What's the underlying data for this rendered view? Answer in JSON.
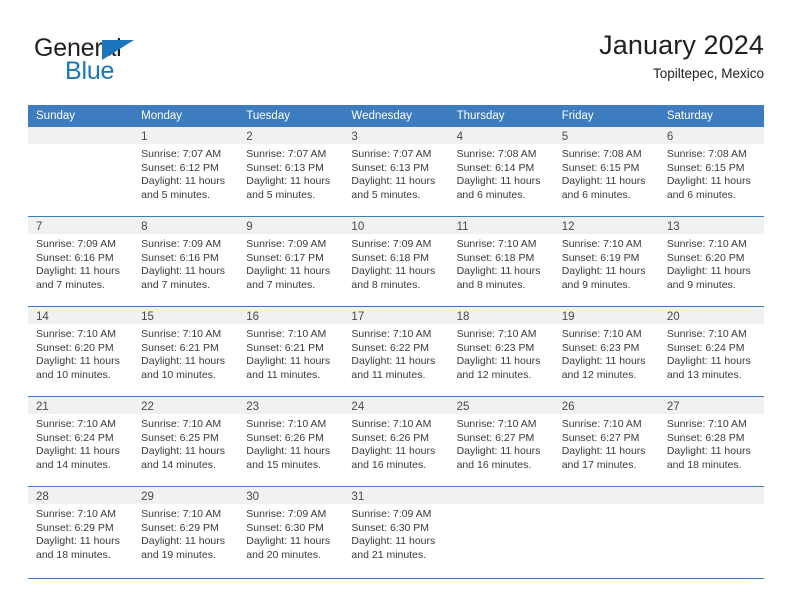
{
  "brand": {
    "name_part1": "General",
    "name_part2": "Blue",
    "triangle_icon": "triangle-icon",
    "colors": {
      "dark": "#231f20",
      "blue": "#1b75bc"
    }
  },
  "header": {
    "title": "January 2024",
    "subtitle": "Topiltepec, Mexico"
  },
  "theme": {
    "header_blue": "#3d7cbf",
    "daynum_band": "#f1f1f1",
    "text": "#3a3a3a"
  },
  "calendar": {
    "weekday_headers": [
      "Sunday",
      "Monday",
      "Tuesday",
      "Wednesday",
      "Thursday",
      "Friday",
      "Saturday"
    ],
    "weeks": [
      [
        {
          "day": "",
          "empty": true,
          "sunrise": "",
          "sunset": "",
          "daylight_line1": "",
          "daylight_line2": ""
        },
        {
          "day": "1",
          "sunrise": "Sunrise: 7:07 AM",
          "sunset": "Sunset: 6:12 PM",
          "daylight_line1": "Daylight: 11 hours",
          "daylight_line2": "and 5 minutes."
        },
        {
          "day": "2",
          "sunrise": "Sunrise: 7:07 AM",
          "sunset": "Sunset: 6:13 PM",
          "daylight_line1": "Daylight: 11 hours",
          "daylight_line2": "and 5 minutes."
        },
        {
          "day": "3",
          "sunrise": "Sunrise: 7:07 AM",
          "sunset": "Sunset: 6:13 PM",
          "daylight_line1": "Daylight: 11 hours",
          "daylight_line2": "and 5 minutes."
        },
        {
          "day": "4",
          "sunrise": "Sunrise: 7:08 AM",
          "sunset": "Sunset: 6:14 PM",
          "daylight_line1": "Daylight: 11 hours",
          "daylight_line2": "and 6 minutes."
        },
        {
          "day": "5",
          "sunrise": "Sunrise: 7:08 AM",
          "sunset": "Sunset: 6:15 PM",
          "daylight_line1": "Daylight: 11 hours",
          "daylight_line2": "and 6 minutes."
        },
        {
          "day": "6",
          "sunrise": "Sunrise: 7:08 AM",
          "sunset": "Sunset: 6:15 PM",
          "daylight_line1": "Daylight: 11 hours",
          "daylight_line2": "and 6 minutes."
        }
      ],
      [
        {
          "day": "7",
          "sunrise": "Sunrise: 7:09 AM",
          "sunset": "Sunset: 6:16 PM",
          "daylight_line1": "Daylight: 11 hours",
          "daylight_line2": "and 7 minutes."
        },
        {
          "day": "8",
          "sunrise": "Sunrise: 7:09 AM",
          "sunset": "Sunset: 6:16 PM",
          "daylight_line1": "Daylight: 11 hours",
          "daylight_line2": "and 7 minutes."
        },
        {
          "day": "9",
          "sunrise": "Sunrise: 7:09 AM",
          "sunset": "Sunset: 6:17 PM",
          "daylight_line1": "Daylight: 11 hours",
          "daylight_line2": "and 7 minutes."
        },
        {
          "day": "10",
          "sunrise": "Sunrise: 7:09 AM",
          "sunset": "Sunset: 6:18 PM",
          "daylight_line1": "Daylight: 11 hours",
          "daylight_line2": "and 8 minutes."
        },
        {
          "day": "11",
          "sunrise": "Sunrise: 7:10 AM",
          "sunset": "Sunset: 6:18 PM",
          "daylight_line1": "Daylight: 11 hours",
          "daylight_line2": "and 8 minutes."
        },
        {
          "day": "12",
          "sunrise": "Sunrise: 7:10 AM",
          "sunset": "Sunset: 6:19 PM",
          "daylight_line1": "Daylight: 11 hours",
          "daylight_line2": "and 9 minutes."
        },
        {
          "day": "13",
          "sunrise": "Sunrise: 7:10 AM",
          "sunset": "Sunset: 6:20 PM",
          "daylight_line1": "Daylight: 11 hours",
          "daylight_line2": "and 9 minutes."
        }
      ],
      [
        {
          "day": "14",
          "sunrise": "Sunrise: 7:10 AM",
          "sunset": "Sunset: 6:20 PM",
          "daylight_line1": "Daylight: 11 hours",
          "daylight_line2": "and 10 minutes."
        },
        {
          "day": "15",
          "sunrise": "Sunrise: 7:10 AM",
          "sunset": "Sunset: 6:21 PM",
          "daylight_line1": "Daylight: 11 hours",
          "daylight_line2": "and 10 minutes."
        },
        {
          "day": "16",
          "sunrise": "Sunrise: 7:10 AM",
          "sunset": "Sunset: 6:21 PM",
          "daylight_line1": "Daylight: 11 hours",
          "daylight_line2": "and 11 minutes."
        },
        {
          "day": "17",
          "sunrise": "Sunrise: 7:10 AM",
          "sunset": "Sunset: 6:22 PM",
          "daylight_line1": "Daylight: 11 hours",
          "daylight_line2": "and 11 minutes."
        },
        {
          "day": "18",
          "sunrise": "Sunrise: 7:10 AM",
          "sunset": "Sunset: 6:23 PM",
          "daylight_line1": "Daylight: 11 hours",
          "daylight_line2": "and 12 minutes."
        },
        {
          "day": "19",
          "sunrise": "Sunrise: 7:10 AM",
          "sunset": "Sunset: 6:23 PM",
          "daylight_line1": "Daylight: 11 hours",
          "daylight_line2": "and 12 minutes."
        },
        {
          "day": "20",
          "sunrise": "Sunrise: 7:10 AM",
          "sunset": "Sunset: 6:24 PM",
          "daylight_line1": "Daylight: 11 hours",
          "daylight_line2": "and 13 minutes."
        }
      ],
      [
        {
          "day": "21",
          "sunrise": "Sunrise: 7:10 AM",
          "sunset": "Sunset: 6:24 PM",
          "daylight_line1": "Daylight: 11 hours",
          "daylight_line2": "and 14 minutes."
        },
        {
          "day": "22",
          "sunrise": "Sunrise: 7:10 AM",
          "sunset": "Sunset: 6:25 PM",
          "daylight_line1": "Daylight: 11 hours",
          "daylight_line2": "and 14 minutes."
        },
        {
          "day": "23",
          "sunrise": "Sunrise: 7:10 AM",
          "sunset": "Sunset: 6:26 PM",
          "daylight_line1": "Daylight: 11 hours",
          "daylight_line2": "and 15 minutes."
        },
        {
          "day": "24",
          "sunrise": "Sunrise: 7:10 AM",
          "sunset": "Sunset: 6:26 PM",
          "daylight_line1": "Daylight: 11 hours",
          "daylight_line2": "and 16 minutes."
        },
        {
          "day": "25",
          "sunrise": "Sunrise: 7:10 AM",
          "sunset": "Sunset: 6:27 PM",
          "daylight_line1": "Daylight: 11 hours",
          "daylight_line2": "and 16 minutes."
        },
        {
          "day": "26",
          "sunrise": "Sunrise: 7:10 AM",
          "sunset": "Sunset: 6:27 PM",
          "daylight_line1": "Daylight: 11 hours",
          "daylight_line2": "and 17 minutes."
        },
        {
          "day": "27",
          "sunrise": "Sunrise: 7:10 AM",
          "sunset": "Sunset: 6:28 PM",
          "daylight_line1": "Daylight: 11 hours",
          "daylight_line2": "and 18 minutes."
        }
      ],
      [
        {
          "day": "28",
          "sunrise": "Sunrise: 7:10 AM",
          "sunset": "Sunset: 6:29 PM",
          "daylight_line1": "Daylight: 11 hours",
          "daylight_line2": "and 18 minutes."
        },
        {
          "day": "29",
          "sunrise": "Sunrise: 7:10 AM",
          "sunset": "Sunset: 6:29 PM",
          "daylight_line1": "Daylight: 11 hours",
          "daylight_line2": "and 19 minutes."
        },
        {
          "day": "30",
          "sunrise": "Sunrise: 7:09 AM",
          "sunset": "Sunset: 6:30 PM",
          "daylight_line1": "Daylight: 11 hours",
          "daylight_line2": "and 20 minutes."
        },
        {
          "day": "31",
          "sunrise": "Sunrise: 7:09 AM",
          "sunset": "Sunset: 6:30 PM",
          "daylight_line1": "Daylight: 11 hours",
          "daylight_line2": "and 21 minutes."
        },
        {
          "day": "",
          "empty": true,
          "sunrise": "",
          "sunset": "",
          "daylight_line1": "",
          "daylight_line2": ""
        },
        {
          "day": "",
          "empty": true,
          "sunrise": "",
          "sunset": "",
          "daylight_line1": "",
          "daylight_line2": ""
        },
        {
          "day": "",
          "empty": true,
          "sunrise": "",
          "sunset": "",
          "daylight_line1": "",
          "daylight_line2": ""
        }
      ]
    ]
  }
}
